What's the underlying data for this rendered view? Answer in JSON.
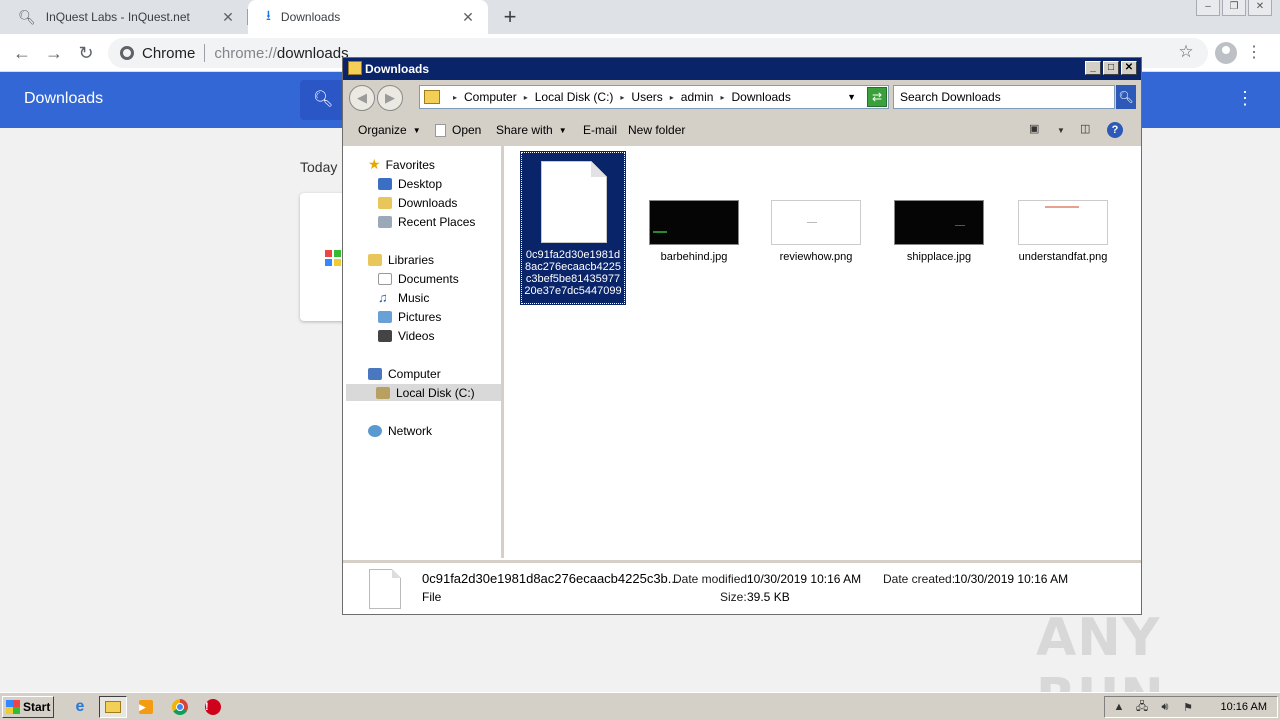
{
  "chrome": {
    "tabs": [
      {
        "title": "InQuest Labs - InQuest.net",
        "icon": "search-icon"
      },
      {
        "title": "Downloads",
        "icon": "download-icon"
      }
    ],
    "omnibox": {
      "origin": "Chrome",
      "scheme": "chrome://",
      "path": "downloads"
    },
    "page": {
      "header_title": "Downloads",
      "section_label": "Today"
    }
  },
  "explorer": {
    "title": "Downloads",
    "breadcrumb": [
      "Computer",
      "Local Disk (C:)",
      "Users",
      "admin",
      "Downloads"
    ],
    "search_placeholder": "Search Downloads",
    "commands": {
      "organize": "Organize",
      "open": "Open",
      "share_with": "Share with",
      "email": "E-mail",
      "new_folder": "New folder"
    },
    "nav": {
      "favorites": "Favorites",
      "desktop": "Desktop",
      "downloads": "Downloads",
      "recent_places": "Recent Places",
      "libraries": "Libraries",
      "documents": "Documents",
      "music": "Music",
      "pictures": "Pictures",
      "videos": "Videos",
      "computer": "Computer",
      "local_disk": "Local Disk (C:)",
      "network": "Network"
    },
    "files": [
      {
        "name": "0c91fa2d30e1981d8ac276ecaacb4225c3bef5be8143597720e37e7dc5447099",
        "selected": true
      },
      {
        "name": "barbehind.jpg"
      },
      {
        "name": "reviewhow.png"
      },
      {
        "name": "shipplace.jpg"
      },
      {
        "name": "understandfat.png"
      }
    ],
    "details": {
      "name": "0c91fa2d30e1981d8ac276ecaacb4225c3b...",
      "type": "File",
      "date_modified_label": "Date modified:",
      "date_modified": "10/30/2019 10:16 AM",
      "date_created_label": "Date created:",
      "date_created": "10/30/2019 10:16 AM",
      "size_label": "Size:",
      "size": "39.5 KB"
    }
  },
  "taskbar": {
    "start": "Start",
    "clock": "10:16 AM"
  },
  "watermark": "ANY RUN"
}
